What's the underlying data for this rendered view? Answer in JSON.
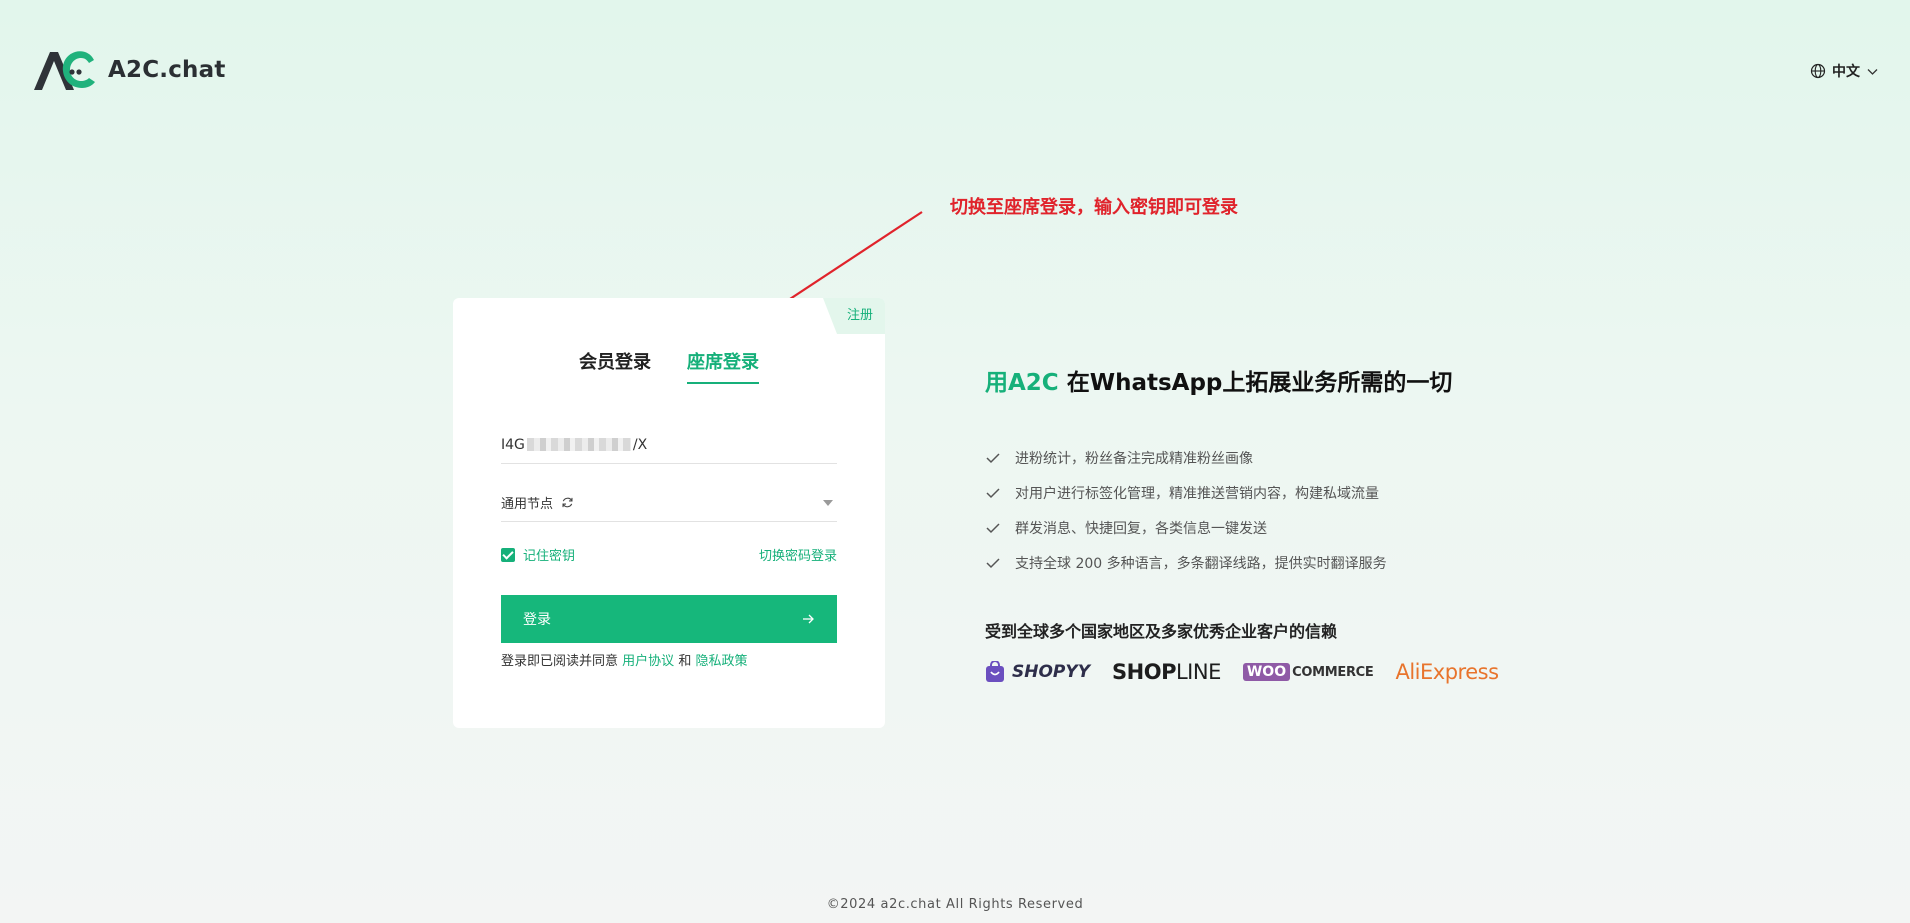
{
  "header": {
    "logo_text": "A2C.chat",
    "language": "中文"
  },
  "annotation": {
    "text": "切换至座席登录，输入密钥即可登录"
  },
  "login_card": {
    "register_label": "注册",
    "tabs": [
      {
        "label": "会员登录",
        "active": false
      },
      {
        "label": "座席登录",
        "active": true
      }
    ],
    "key_value_prefix": "I4G",
    "key_value_suffix": "/X",
    "node_label": "通用节点",
    "remember_label": "记住密钥",
    "remember_checked": true,
    "switch_label": "切换密码登录",
    "login_button_label": "登录",
    "agreement_prefix": "登录即已阅读并同意",
    "agreement_user": "用户协议",
    "agreement_and": "和",
    "agreement_privacy": "隐私政策"
  },
  "marketing": {
    "headline_accent": "用A2C",
    "headline_rest": " 在WhatsApp上拓展业务所需的一切",
    "features": [
      "进粉统计，粉丝备注完成精准粉丝画像",
      "对用户进行标签化管理，精准推送营销内容，构建私域流量",
      "群发消息、快捷回复，各类信息一键发送",
      "支持全球 200 多种语言，多条翻译线路，提供实时翻译服务"
    ],
    "trust_text": "受到全球多个国家地区及多家优秀企业客户的信赖",
    "partners": {
      "shopyy": "SHOPYY",
      "shopline_bold": "SHOP",
      "shopline_thin": "LINE",
      "woo_badge": "WOO",
      "woo_text": "COMMERCE",
      "aliexpress": "AliExpress"
    }
  },
  "footer": {
    "text": "©2024 a2c.chat All Rights Reserved"
  },
  "colors": {
    "accent": "#16b07a",
    "annotation_red": "#e0232b"
  }
}
